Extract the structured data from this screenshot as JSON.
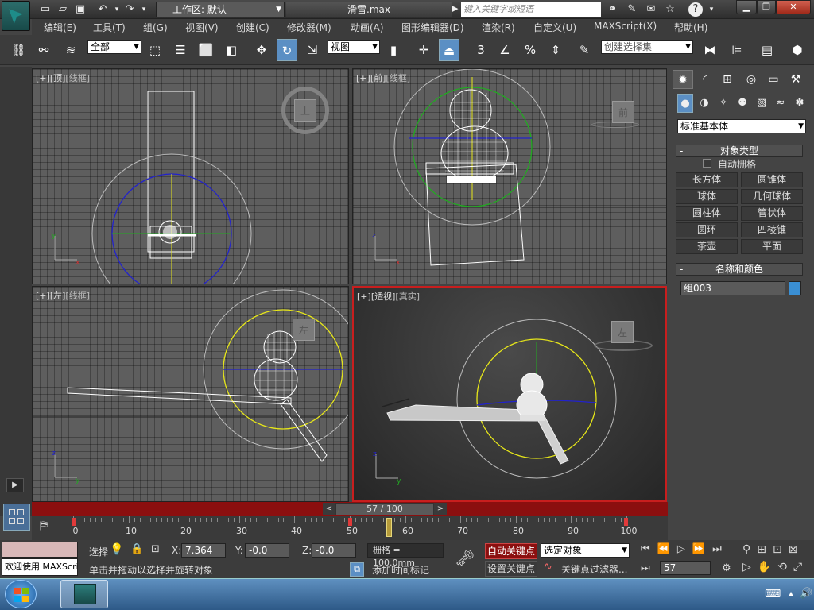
{
  "title_bar": {
    "workspace_label": "工作区: 默认",
    "filename": "滑雪.max",
    "search_placeholder": "键入关键字或短语"
  },
  "menu": [
    "编辑(E)",
    "工具(T)",
    "组(G)",
    "视图(V)",
    "创建(C)",
    "修改器(M)",
    "动画(A)",
    "图形编辑器(D)",
    "渲染(R)",
    "自定义(U)",
    "MAXScript(X)",
    "帮助(H)"
  ],
  "toolbar": {
    "selection_filter": "全部",
    "ref_coord": "视图",
    "named_selection_placeholder": "创建选择集",
    "snap_label": "3",
    "percent_label": "%"
  },
  "viewports": {
    "top": {
      "plus": "[+]",
      "name": "[顶]",
      "mode": "[线框]",
      "cube_label": "上"
    },
    "front": {
      "plus": "[+]",
      "name": "[前]",
      "mode": "[线框]",
      "cube_label": "前"
    },
    "left": {
      "plus": "[+]",
      "name": "[左]",
      "mode": "[线框]",
      "cube_label": "左"
    },
    "perspective": {
      "plus": "[+]",
      "name": "[透视]",
      "mode": "[真实]",
      "cube_label": "左"
    }
  },
  "command_panel": {
    "category_dropdown": "标准基本体",
    "object_type_header": "对象类型",
    "auto_grid_label": "自动栅格",
    "object_buttons": [
      "长方体",
      "圆锥体",
      "球体",
      "几何球体",
      "圆柱体",
      "管状体",
      "圆环",
      "四棱锥",
      "茶壶",
      "平面"
    ],
    "name_color_header": "名称和颜色",
    "object_name": "组003",
    "object_color": "#3a8fd4"
  },
  "timeline": {
    "frame_display": "57 / 100",
    "current_frame": 57,
    "total_frames": 100,
    "ticks": [
      "0",
      "10",
      "20",
      "30",
      "40",
      "50",
      "60",
      "70",
      "80",
      "90",
      "100"
    ]
  },
  "status": {
    "maxscript_text": "欢迎使用 MAXScri",
    "selected_label": "选择",
    "x_label": "X:",
    "x_value": "7.364",
    "y_label": "Y:",
    "y_value": "-0.0",
    "z_label": "Z:",
    "z_value": "-0.0",
    "grid_text": "栅格 = 100.0mm",
    "prompt_text": "单击并拖动以选择并旋转对象",
    "add_time_tag": "添加时间标记",
    "auto_key": "自动关键点",
    "set_key": "设置关键点",
    "key_mode_dropdown": "选定对象",
    "key_filters": "关键点过滤器...",
    "frame_field": "57"
  },
  "colors": {
    "autokey_red": "#8b0f0f",
    "viewport_active_border": "#c81e1e",
    "selection_yellow": "#e6e61a",
    "axis_green": "#22aa22",
    "axis_blue": "#2222cc"
  }
}
